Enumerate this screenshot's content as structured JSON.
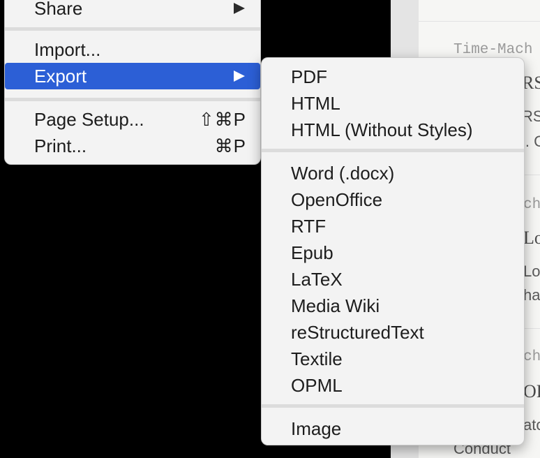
{
  "document": {
    "lines": [
      {
        "text": "Time-Mach",
        "style": "mono"
      },
      {
        "text": "RS",
        "style": "serif"
      },
      {
        "text": "RS",
        "style": "text"
      },
      {
        "text": "l. C",
        "style": "text"
      },
      {
        "text": "ch",
        "style": "mono"
      },
      {
        "text": "Lo",
        "style": "serif"
      },
      {
        "text": "Lo",
        "style": "text"
      },
      {
        "text": "ha",
        "style": "text"
      },
      {
        "text": "ch",
        "style": "mono"
      },
      {
        "text": "OF",
        "style": "serif"
      },
      {
        "text": "ato",
        "style": "text"
      },
      {
        "text": "Conduct",
        "style": "text"
      }
    ]
  },
  "file_menu": {
    "share": {
      "label": "Share"
    },
    "import": {
      "label": "Import..."
    },
    "export": {
      "label": "Export"
    },
    "page_setup": {
      "label": "Page Setup...",
      "shortcut": "⇧⌘P"
    },
    "print": {
      "label": "Print...",
      "shortcut": "⌘P"
    }
  },
  "export_menu": {
    "items": [
      {
        "label": "PDF"
      },
      {
        "label": "HTML"
      },
      {
        "label": "HTML (Without Styles)"
      },
      {
        "label": "Word (.docx)"
      },
      {
        "label": "OpenOffice"
      },
      {
        "label": "RTF"
      },
      {
        "label": "Epub"
      },
      {
        "label": "LaTeX"
      },
      {
        "label": "Media Wiki"
      },
      {
        "label": "reStructuredText"
      },
      {
        "label": "Textile"
      },
      {
        "label": "OPML"
      },
      {
        "label": "Image"
      }
    ]
  },
  "colors": {
    "highlight": "#2c5fd6",
    "menu_background": "#f3f3f3",
    "separator": "#dcdcdc",
    "desktop": "#000000"
  }
}
